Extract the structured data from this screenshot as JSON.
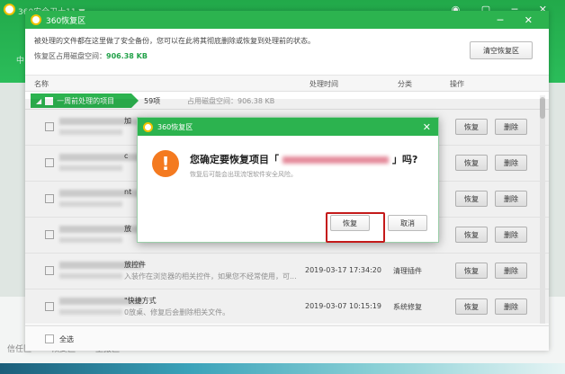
{
  "outer": {
    "title": "360安全卫士11 ▼",
    "side_text": "中",
    "controls": "◉ ▢ ─ ✕",
    "bottom_tabs": [
      "信任区",
      "恢复区",
      "上报区"
    ]
  },
  "window": {
    "title": "360恢复区",
    "controls": "─ ✕",
    "description": "被处理的文件都在这里做了安全备份，您可以在此将其彻底删除或恢复到处理前的状态。",
    "usage_label": "恢复区占用磁盘空间：",
    "usage_value": "906.38 KB",
    "clear_button": "清空恢复区"
  },
  "table": {
    "headers": {
      "name": "名称",
      "time": "处理时间",
      "category": "分类",
      "action": "操作"
    },
    "group": {
      "label": "一周前处理的项目",
      "count": "59项",
      "size": "占用磁盘空间：906.38 KB"
    },
    "restore_label": "恢复",
    "delete_label": "删除",
    "rows": [
      {
        "title": "加",
        "note": "",
        "time": "",
        "category": ""
      },
      {
        "title": "c",
        "note": "",
        "time": "",
        "category": ""
      },
      {
        "title": "nt",
        "note": "",
        "time": "",
        "category": ""
      },
      {
        "title": "放",
        "note": "",
        "time": "",
        "category": ""
      },
      {
        "title": "放控件",
        "note": "入装作在浏览器的相关控件，如果您不经常使用，可...",
        "time": "2019-03-17 17:34:20",
        "category": "清理插件"
      },
      {
        "title": "\"快捷方式",
        "note": "0放桌、修复后会删除相关文件。",
        "time": "2019-03-07 10:15:19",
        "category": "系统修复"
      }
    ],
    "select_all": "全选"
  },
  "dialog": {
    "title": "360恢复区",
    "close": "✕",
    "question_prefix": "您确定要恢复项目「",
    "question_suffix": "」吗?",
    "hint": "恢复后可能会出现流氓软件安全风险。",
    "restore_button": "恢复",
    "cancel_button": "取消",
    "warning_glyph": "!"
  }
}
